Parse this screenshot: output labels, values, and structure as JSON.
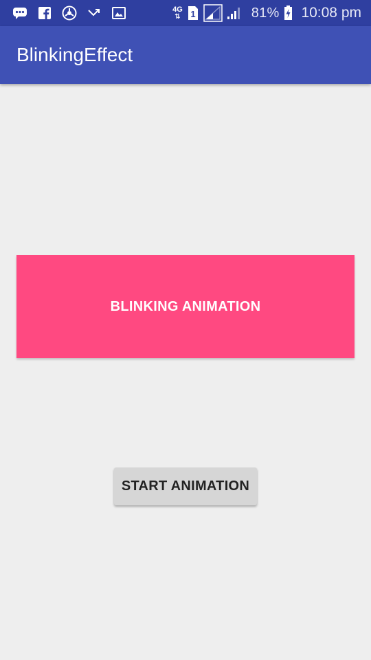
{
  "status_bar": {
    "icons_left": [
      "chat-icon",
      "facebook-icon",
      "vpn-icon",
      "missed-call-icon",
      "image-icon"
    ],
    "network_type": "4G",
    "sim_slot": "1",
    "battery_percent": "81%",
    "time": "10:08 pm"
  },
  "app_bar": {
    "title": "BlinkingEffect",
    "color": "#3f51b5",
    "status_color": "#2f3fa0"
  },
  "main": {
    "blink_label": "BLINKING ANIMATION",
    "blink_color": "#ff4981",
    "start_button_label": "START ANIMATION",
    "background": "#eeeeee"
  }
}
